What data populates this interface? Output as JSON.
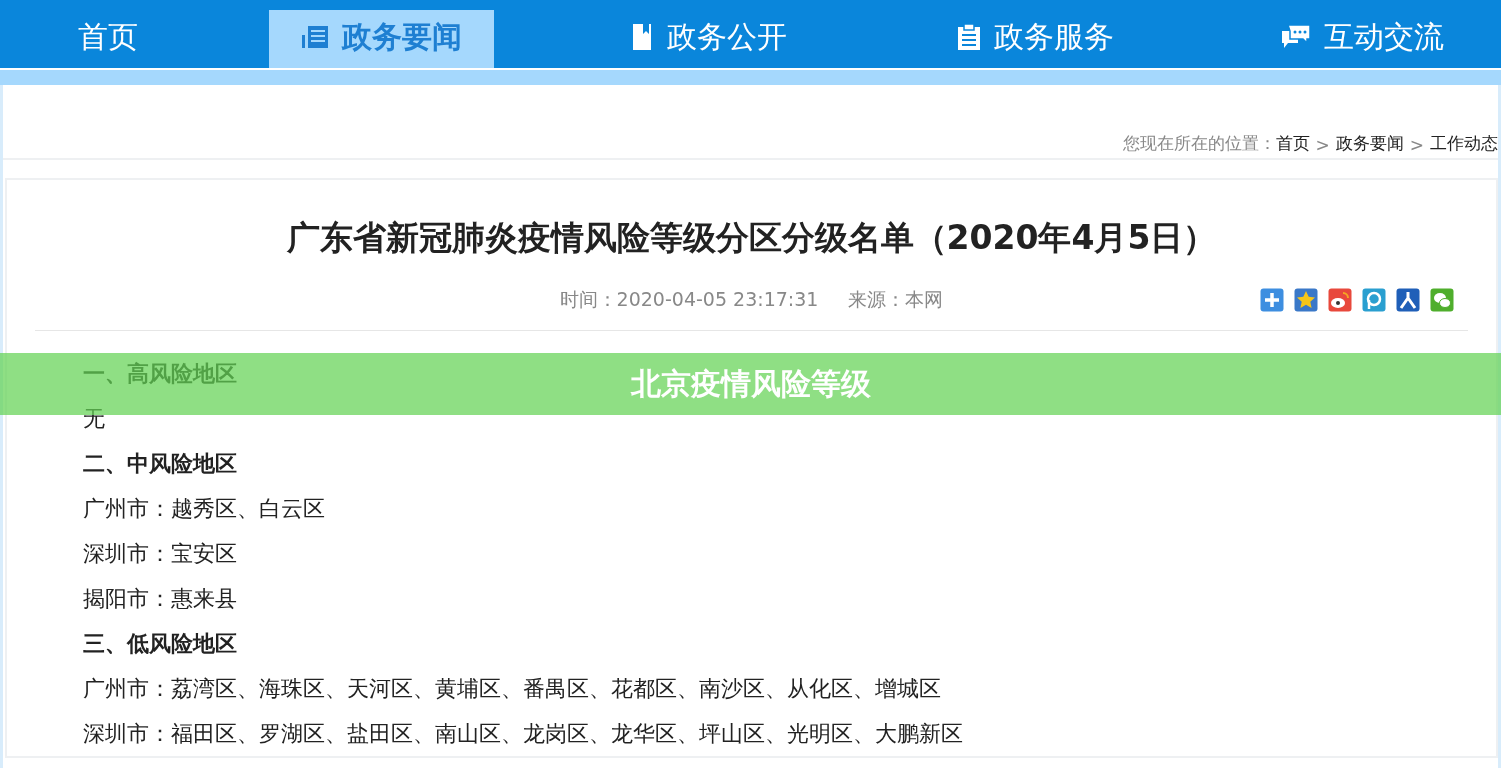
{
  "nav": {
    "tabs": [
      {
        "label": "首页",
        "selected": false
      },
      {
        "label": "政务要闻",
        "selected": true
      },
      {
        "label": "政务公开",
        "selected": false
      },
      {
        "label": "政务服务",
        "selected": false
      },
      {
        "label": "互动交流",
        "selected": false
      }
    ]
  },
  "breadcrumb": {
    "prefix": "您现在所在的位置：",
    "items": [
      "首页",
      "政务要闻",
      "工作动态"
    ],
    "separator": ">"
  },
  "article": {
    "title": "广东省新冠肺炎疫情风险等级分区分级名单（2020年4月5日）",
    "time": "时间：2020-04-05 23:17:31",
    "source": "来源：本网",
    "share": [
      {
        "kind": "plus",
        "color": "#3d8ee0"
      },
      {
        "kind": "star",
        "color": "#3a78c8"
      },
      {
        "kind": "weibo",
        "color": "#e8483c"
      },
      {
        "kind": "p",
        "color": "#2a9fd0"
      },
      {
        "kind": "person",
        "color": "#1f5fb8"
      },
      {
        "kind": "wechat",
        "color": "#4fae2c"
      }
    ],
    "lines": [
      {
        "kind": "heading",
        "text": "一、高风险地区"
      },
      {
        "kind": "line",
        "text": "无"
      },
      {
        "kind": "heading",
        "text": "二、中风险地区"
      },
      {
        "kind": "line",
        "text": "广州市：越秀区、白云区"
      },
      {
        "kind": "line",
        "text": "深圳市：宝安区"
      },
      {
        "kind": "line",
        "text": "揭阳市：惠来县"
      },
      {
        "kind": "heading",
        "text": "三、低风险地区"
      },
      {
        "kind": "line",
        "text": "广州市：荔湾区、海珠区、天河区、黄埔区、番禺区、花都区、南沙区、从化区、增城区"
      },
      {
        "kind": "line",
        "text": "深圳市：福田区、罗湖区、盐田区、南山区、龙岗区、龙华区、坪山区、光明区、大鹏新区"
      }
    ]
  },
  "banner": {
    "text": "北京疫情风险等级"
  }
}
